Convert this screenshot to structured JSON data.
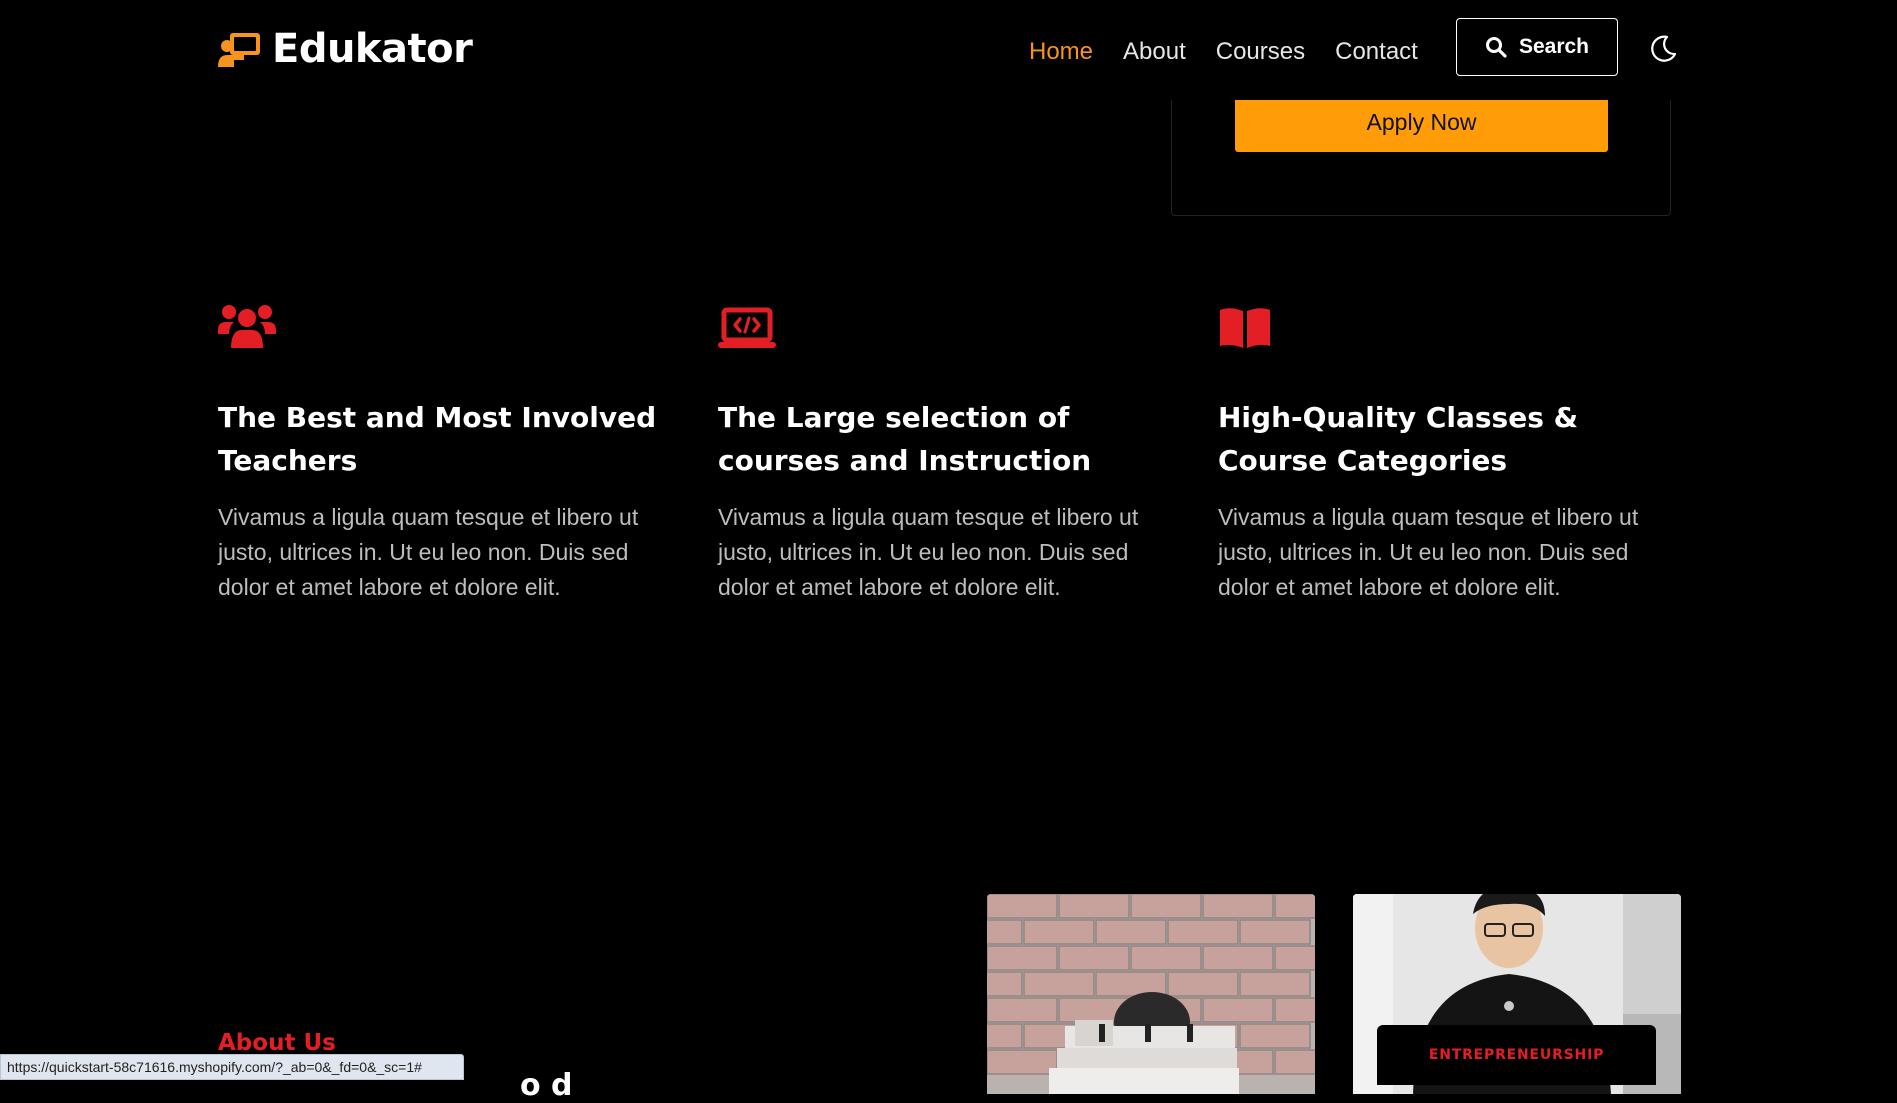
{
  "header": {
    "logo_text": "Edukator",
    "nav": [
      {
        "label": "Home",
        "active": true
      },
      {
        "label": "About",
        "active": false
      },
      {
        "label": "Courses",
        "active": false
      },
      {
        "label": "Contact",
        "active": false
      }
    ],
    "search_label": "Search"
  },
  "apply": {
    "button_label": "Apply Now"
  },
  "features": [
    {
      "icon": "users-icon",
      "title": "The Best and Most Involved Teachers",
      "text": "Vivamus a ligula quam tesque et libero ut justo, ultrices in. Ut eu leo non. Duis sed dolor et amet labore et dolore elit."
    },
    {
      "icon": "laptop-code-icon",
      "title": "The Large selection of courses and Instruction",
      "text": "Vivamus a ligula quam tesque et libero ut justo, ultrices in. Ut eu leo non. Duis sed dolor et amet labore et dolore elit."
    },
    {
      "icon": "book-open-icon",
      "title": "High-Quality Classes & Course Categories",
      "text": "Vivamus a ligula quam tesque et libero ut justo, ultrices in. Ut eu leo non. Duis sed dolor et amet labore et dolore elit."
    }
  ],
  "about": {
    "label": "About Us",
    "heading_fragment": "o   d",
    "photo_badge": "ENTREPRENEURSHIP"
  },
  "status_url": "https://quickstart-58c71616.myshopify.com/?_ab=0&_fd=0&_sc=1#",
  "colors": {
    "accent_orange": "#f7941d",
    "apply_button": "#ff9c08",
    "feature_icon_red": "#e31e24",
    "background": "#000000"
  }
}
